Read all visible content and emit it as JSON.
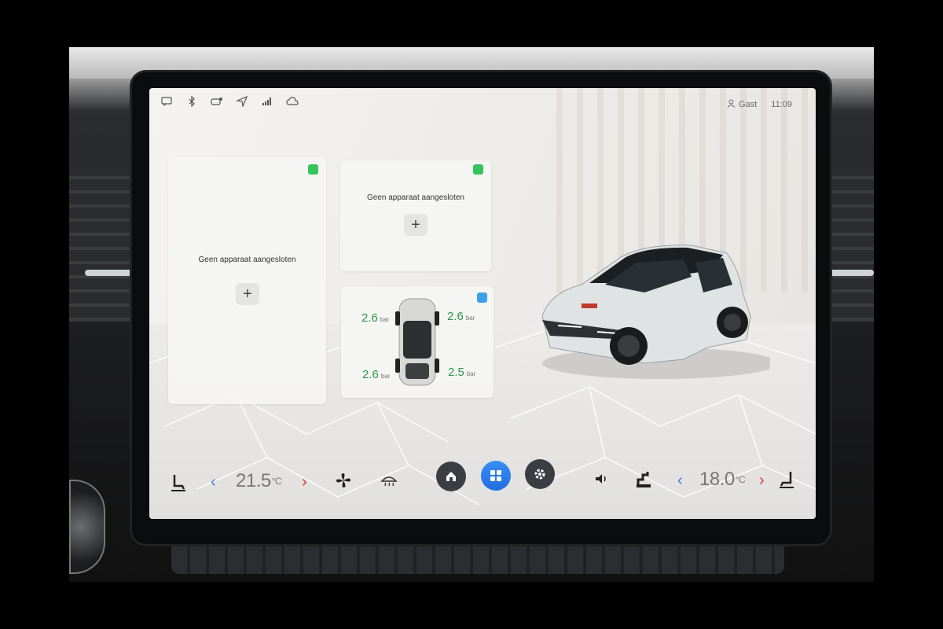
{
  "status": {
    "icons": [
      "message-icon",
      "bluetooth-icon",
      "car-connect-icon",
      "navigation-icon",
      "signal-icon",
      "cloud-icon"
    ],
    "user_label": "Gast",
    "time": "11:09"
  },
  "cards": {
    "left": {
      "label": "Geen apparaat aangesloten",
      "plus": "+"
    },
    "top_right": {
      "label": "Geen apparaat aangesloten",
      "plus": "+"
    },
    "tires": {
      "front_left": "2.6",
      "front_right": "2.6",
      "rear_left": "2.6",
      "rear_right": "2.5",
      "unit": "bar"
    }
  },
  "climate": {
    "left_temp": "21.5",
    "right_temp": "18.0",
    "unit": "°C",
    "chevron_left": "‹",
    "chevron_right": "›"
  },
  "colors": {
    "tire_green": "#2c9a4a",
    "accent_blue": "#1f6fe0",
    "badge_green": "#35c45a",
    "badge_blue": "#3aa3e8"
  }
}
